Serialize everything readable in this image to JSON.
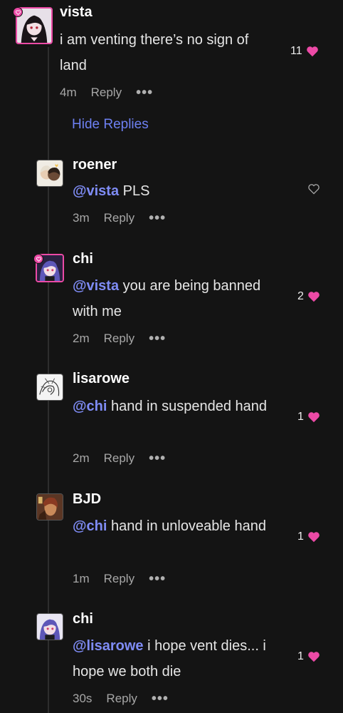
{
  "colors": {
    "background": "#141414",
    "accent_pink": "#ec4aa6",
    "mention_blue": "#7f8cf5",
    "link_blue": "#6d80f2",
    "meta_gray": "#a7a7a7"
  },
  "thread": {
    "hide_replies_label": "Hide Replies"
  },
  "comments": [
    {
      "username": "vista",
      "mention": "",
      "text": "i am venting there’s no sign of land",
      "time": "4m",
      "reply_label": "Reply",
      "more_label": "•••",
      "likes": "11",
      "liked": true,
      "avatar_frame": true,
      "badge": "heart-badge-icon"
    },
    {
      "username": "roener",
      "mention": "@vista",
      "text": "PLS",
      "time": "3m",
      "reply_label": "Reply",
      "more_label": "•••",
      "likes": "",
      "liked": false,
      "avatar_frame": false
    },
    {
      "username": "chi",
      "mention": "@vista",
      "text": "you are being banned with me",
      "time": "2m",
      "reply_label": "Reply",
      "more_label": "•••",
      "likes": "2",
      "liked": true,
      "avatar_frame": true,
      "badge": "heart-badge-icon"
    },
    {
      "username": "lisarowe",
      "mention": "@chi",
      "text": "hand in suspended hand",
      "time": "2m",
      "reply_label": "Reply",
      "more_label": "•••",
      "likes": "1",
      "liked": true,
      "avatar_frame": false
    },
    {
      "username": "BJD",
      "mention": "@chi",
      "text": "hand in unloveable hand",
      "time": "1m",
      "reply_label": "Reply",
      "more_label": "•••",
      "likes": "1",
      "liked": true,
      "avatar_frame": false
    },
    {
      "username": "chi",
      "mention": "@lisarowe",
      "text": "i hope vent dies... i hope we both die",
      "time": "30s",
      "reply_label": "Reply",
      "more_label": "•••",
      "likes": "1",
      "liked": true,
      "avatar_frame": false
    }
  ]
}
